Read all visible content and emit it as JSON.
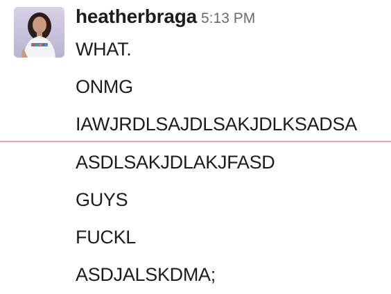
{
  "message_group": {
    "author": "heatherbraga",
    "timestamp": "5:13 PM",
    "messages": [
      "WHAT.",
      "ONMG",
      "IAWJRDLSAJDLSAKJDLKSADSA",
      "ASDLSAKJDLAKJFASD",
      "GUYS",
      "FUCKL",
      "ASDJALSKDMA;"
    ]
  },
  "colors": {
    "username": "#1d1c1d",
    "timestamp": "#6b6b6b",
    "new_messages_divider": "#e9a2ba"
  }
}
